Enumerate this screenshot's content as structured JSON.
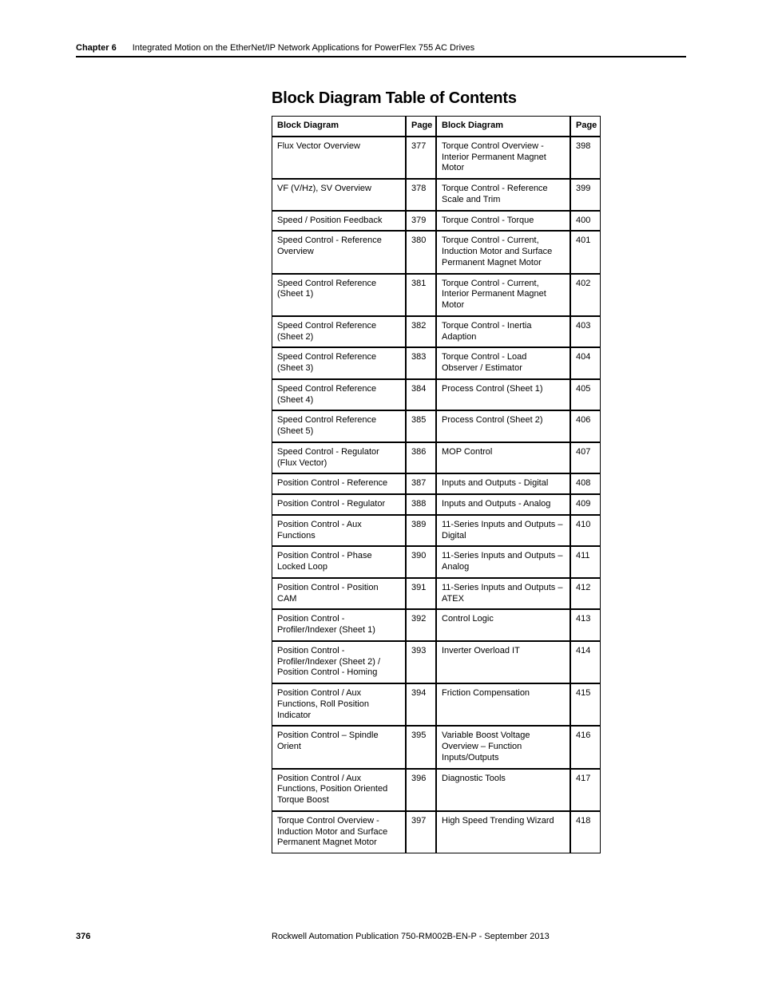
{
  "header": {
    "chapter_label": "Chapter 6",
    "chapter_title": "Integrated Motion on the EtherNet/IP Network Applications for PowerFlex 755 AC Drives"
  },
  "section_title": "Block Diagram Table of Contents",
  "table": {
    "headers": {
      "left_name": "Block Diagram",
      "left_page": "Page",
      "right_name": "Block Diagram",
      "right_page": "Page"
    },
    "rows": [
      {
        "l_name": "Flux Vector Overview",
        "l_page": "377",
        "r_name": "Torque Control Overview - Interior Permanent Magnet Motor",
        "r_page": "398"
      },
      {
        "l_name": "VF (V/Hz), SV Overview",
        "l_page": "378",
        "r_name": "Torque Control - Reference Scale and Trim",
        "r_page": "399"
      },
      {
        "l_name": "Speed / Position Feedback",
        "l_page": "379",
        "r_name": "Torque Control - Torque",
        "r_page": "400"
      },
      {
        "l_name": "Speed Control - Reference Overview",
        "l_page": "380",
        "r_name": "Torque Control - Current, Induction Motor and Surface Permanent Magnet Motor",
        "r_page": "401"
      },
      {
        "l_name": "Speed Control Reference (Sheet 1)",
        "l_page": "381",
        "r_name": "Torque Control - Current, Interior Permanent Magnet Motor",
        "r_page": "402"
      },
      {
        "l_name": "Speed Control Reference (Sheet 2)",
        "l_page": "382",
        "r_name": "Torque Control - Inertia Adaption",
        "r_page": "403"
      },
      {
        "l_name": "Speed Control Reference (Sheet 3)",
        "l_page": "383",
        "r_name": "Torque Control - Load Observer / Estimator",
        "r_page": "404"
      },
      {
        "l_name": "Speed Control Reference (Sheet 4)",
        "l_page": "384",
        "r_name": "Process Control (Sheet 1)",
        "r_page": "405"
      },
      {
        "l_name": "Speed Control Reference (Sheet 5)",
        "l_page": "385",
        "r_name": "Process Control (Sheet 2)",
        "r_page": "406"
      },
      {
        "l_name": "Speed Control - Regulator (Flux Vector)",
        "l_page": "386",
        "r_name": "MOP Control",
        "r_page": "407"
      },
      {
        "l_name": "Position Control - Reference",
        "l_page": "387",
        "r_name": "Inputs and Outputs - Digital",
        "r_page": "408"
      },
      {
        "l_name": "Position Control - Regulator",
        "l_page": "388",
        "r_name": "Inputs and Outputs - Analog",
        "r_page": "409"
      },
      {
        "l_name": "Position Control - Aux Functions",
        "l_page": "389",
        "r_name": "11-Series Inputs and Outputs – Digital",
        "r_page": "410"
      },
      {
        "l_name": "Position Control - Phase Locked Loop",
        "l_page": "390",
        "r_name": "11-Series Inputs and Outputs – Analog",
        "r_page": "411"
      },
      {
        "l_name": "Position Control - Position CAM",
        "l_page": "391",
        "r_name": "11-Series Inputs and Outputs – ATEX",
        "r_page": "412"
      },
      {
        "l_name": "Position Control - Profiler/Indexer (Sheet 1)",
        "l_page": "392",
        "r_name": "Control Logic",
        "r_page": "413"
      },
      {
        "l_name": "Position Control - Profiler/Indexer (Sheet 2) / Position Control - Homing",
        "l_page": "393",
        "r_name": "Inverter Overload IT",
        "r_page": "414"
      },
      {
        "l_name": "Position Control / Aux Functions, Roll Position Indicator",
        "l_page": "394",
        "r_name": "Friction Compensation",
        "r_page": "415"
      },
      {
        "l_name": "Position Control – Spindle Orient",
        "l_page": "395",
        "r_name": "Variable Boost Voltage Overview – Function Inputs/Outputs",
        "r_page": "416"
      },
      {
        "l_name": "Position Control / Aux Functions, Position Oriented Torque Boost",
        "l_page": "396",
        "r_name": "Diagnostic Tools",
        "r_page": "417"
      },
      {
        "l_name": "Torque Control Overview - Induction Motor and Surface Permanent Magnet Motor",
        "l_page": "397",
        "r_name": "High Speed Trending Wizard",
        "r_page": "418"
      }
    ]
  },
  "footer": {
    "page_number": "376",
    "publication": "Rockwell Automation Publication 750-RM002B-EN-P - September 2013"
  }
}
